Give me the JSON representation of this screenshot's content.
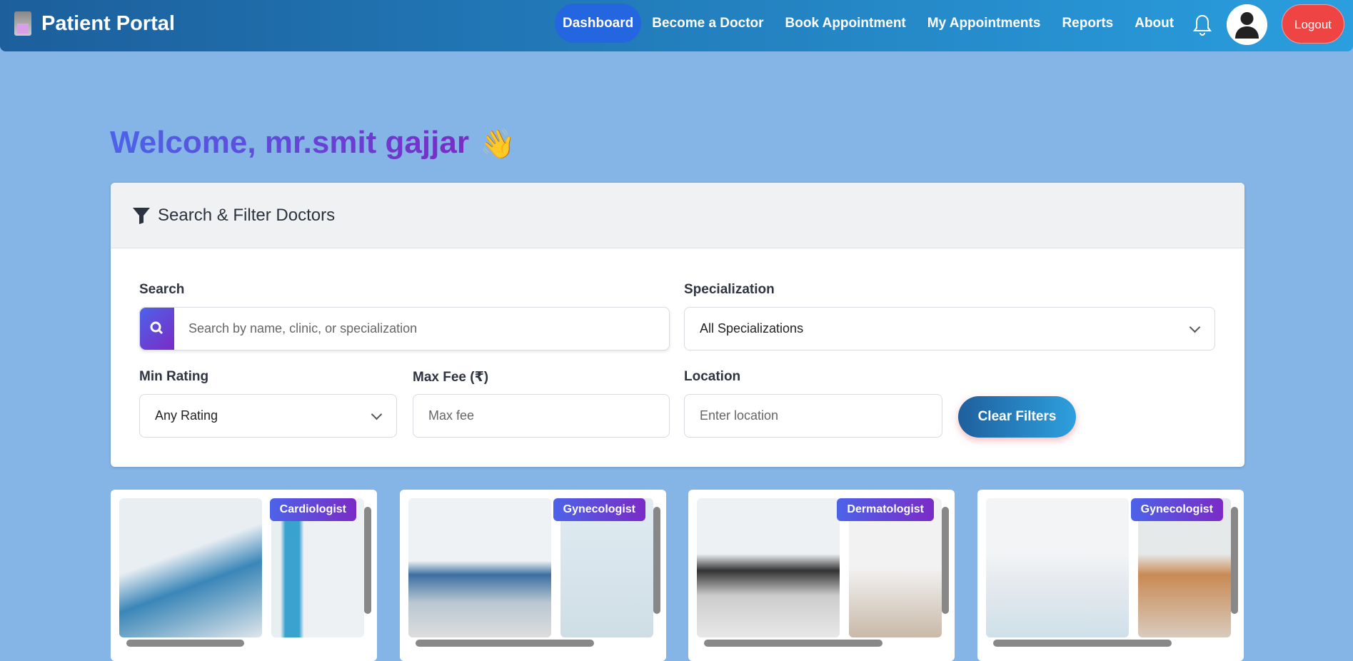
{
  "nav": {
    "brand": "Patient Portal",
    "links": [
      "Dashboard",
      "Become a Doctor",
      "Book Appointment",
      "My Appointments",
      "Reports",
      "About"
    ],
    "active": "Dashboard",
    "logout": "Logout"
  },
  "welcome": {
    "text": "Welcome, mr.smit gajjar",
    "emoji": "👋"
  },
  "filter": {
    "title": "Search & Filter Doctors",
    "search_label": "Search",
    "search_placeholder": "Search by name, clinic, or specialization",
    "spec_label": "Specialization",
    "spec_value": "All Specializations",
    "rating_label": "Min Rating",
    "rating_value": "Any Rating",
    "fee_label": "Max Fee (₹)",
    "fee_placeholder": "Max fee",
    "location_label": "Location",
    "location_placeholder": "Enter location",
    "clear": "Clear Filters"
  },
  "doctors": [
    {
      "specialization": "Cardiologist"
    },
    {
      "specialization": "Gynecologist"
    },
    {
      "specialization": "Dermatologist"
    },
    {
      "specialization": "Gynecologist"
    }
  ],
  "colors": {
    "accent": "#2465e0",
    "logout": "#ee4444",
    "gradient_start": "#4c63e8",
    "gradient_end": "#7b2bc6"
  }
}
